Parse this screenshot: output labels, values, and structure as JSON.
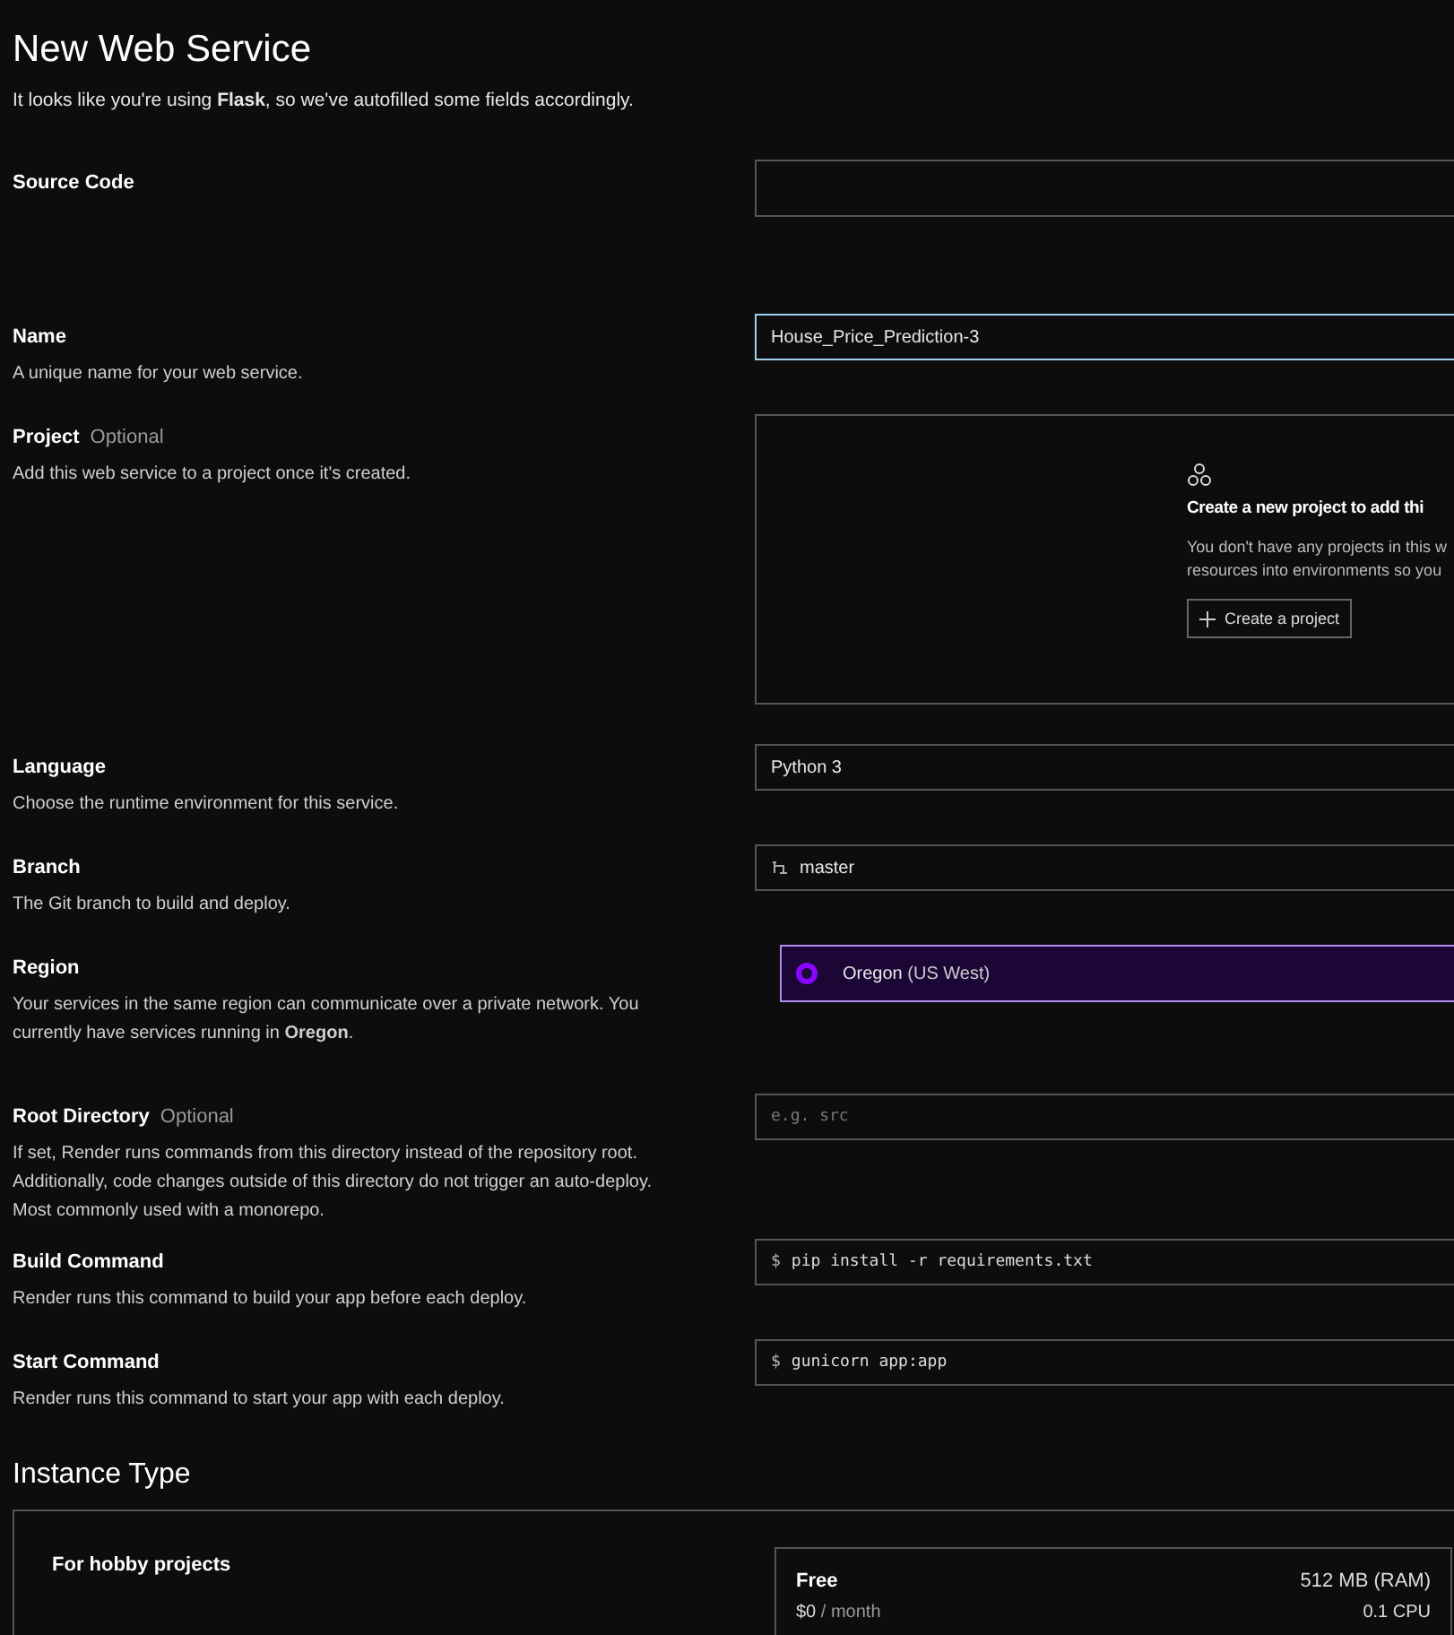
{
  "title": "New Web Service",
  "intro": "It looks like you're using **Flask**, so we've autofilled some fields accordingly.",
  "fields": [
    {
      "kind": "repo",
      "label": "Source Code"
    },
    {
      "kind": "text",
      "label": "Name",
      "description": "A unique name for your web service.",
      "value": "House_Price_Prediction-3",
      "focused": true
    },
    {
      "kind": "project",
      "label": "Project",
      "optional": "Optional",
      "description": "Add this web service to a project once it's created.",
      "empty_title": "Create a new project to add thi",
      "empty_lines": [
        "You don't have any projects in this w",
        "resources into environments so you"
      ],
      "button": "Create a project"
    },
    {
      "kind": "select",
      "label": "Language",
      "description": "Choose the runtime environment for this service.",
      "value": "Python 3"
    },
    {
      "kind": "branch",
      "label": "Branch",
      "description": "The Git branch to build and deploy.",
      "value": "master"
    },
    {
      "kind": "region",
      "label": "Region",
      "description": "Your services in the same region can communicate over a private network. You currently have services running in **Oregon**.",
      "value": "Oregon",
      "value_note": "(US West)",
      "selected": true,
      "color": "#8a05ff"
    },
    {
      "kind": "code",
      "label": "Root Directory",
      "optional": "Optional",
      "description": "If set, Render runs commands from this directory instead of the repository root. Additionally, code changes outside of this directory do not trigger an auto-deploy. Most commonly used with a monorepo.",
      "placeholder": "e.g. src"
    },
    {
      "kind": "code",
      "label": "Build Command",
      "description": "Render runs this command to build your app before each deploy.",
      "prefix": "$",
      "value": "pip install -r requirements.txt"
    },
    {
      "kind": "code",
      "label": "Start Command",
      "description": "Render runs this command to start your app with each deploy.",
      "prefix": "$",
      "value": "gunicorn app:app"
    }
  ],
  "instance": {
    "heading": "Instance Type",
    "group_label": "For hobby projects",
    "plan": {
      "name": "Free",
      "ram": "512 MB (RAM)",
      "price": "$0",
      "period": "/ month",
      "cpu": "0.1 CPU"
    }
  }
}
